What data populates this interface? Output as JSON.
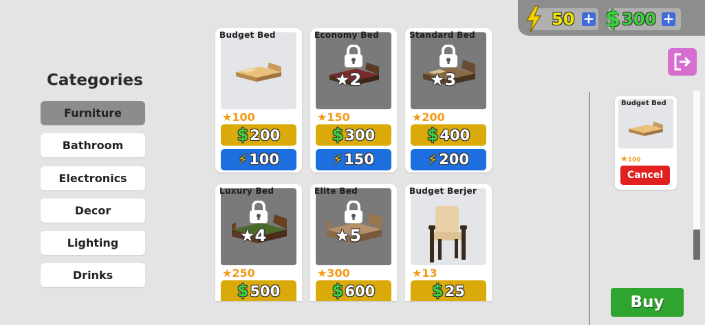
{
  "hud": {
    "energy_value": "50",
    "money_value": "300",
    "plus": "+",
    "energy_icon": "lightning-bolt-icon",
    "money_icon": "dollar-icon"
  },
  "categories": {
    "title": "Categories",
    "items": [
      {
        "label": "Furniture",
        "active": true
      },
      {
        "label": "Bathroom",
        "active": false
      },
      {
        "label": "Electronics",
        "active": false
      },
      {
        "label": "Decor",
        "active": false
      },
      {
        "label": "Lighting",
        "active": false
      },
      {
        "label": "Drinks",
        "active": false
      }
    ]
  },
  "items": [
    {
      "name": "Budget Bed",
      "stars": "100",
      "price_money": "200",
      "price_energy": "100",
      "locked": false,
      "unlock_stars": ""
    },
    {
      "name": "Economy Bed",
      "stars": "150",
      "price_money": "300",
      "price_energy": "150",
      "locked": true,
      "unlock_stars": "2"
    },
    {
      "name": "Standard Bed",
      "stars": "200",
      "price_money": "400",
      "price_energy": "200",
      "locked": true,
      "unlock_stars": "3"
    },
    {
      "name": "Luxury Bed",
      "stars": "250",
      "price_money": "500",
      "price_energy": "",
      "locked": true,
      "unlock_stars": "4"
    },
    {
      "name": "Elite Bed",
      "stars": "300",
      "price_money": "600",
      "price_energy": "",
      "locked": true,
      "unlock_stars": "5"
    },
    {
      "name": "Budget Berjer",
      "stars": "13",
      "price_money": "25",
      "price_energy": "",
      "locked": false,
      "unlock_stars": ""
    }
  ],
  "symbols": {
    "star": "★",
    "dollar": "$",
    "bolt": "⚡"
  },
  "cart": {
    "item_name": "Budget Bed",
    "stars": "100",
    "cancel_label": "Cancel"
  },
  "buy_label": "Buy",
  "colors": {
    "gold_price": "#d9aa0a",
    "blue_price": "#1d6fe0",
    "buy_green": "#2fa52f",
    "cancel_red": "#e0211f",
    "exit_pink": "#d66ed0"
  }
}
